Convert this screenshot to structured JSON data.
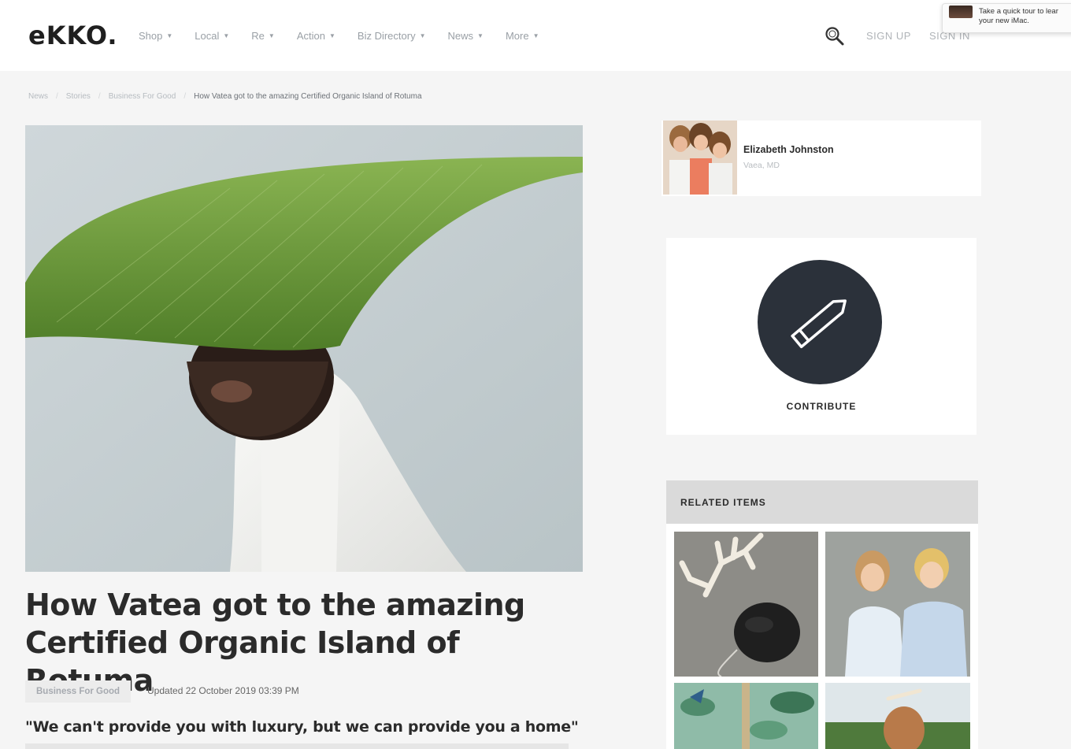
{
  "header": {
    "logo": "eKKO.",
    "nav": [
      {
        "label": "Shop"
      },
      {
        "label": "Local"
      },
      {
        "label": "Re"
      },
      {
        "label": "Action"
      },
      {
        "label": "Biz Directory"
      },
      {
        "label": "News"
      },
      {
        "label": "More"
      }
    ],
    "search_icon": "search-icon",
    "signup": "SIGN UP",
    "signin": "SIGN IN"
  },
  "notification": {
    "text_line1": "Take a quick tour to lear",
    "text_line2": "your new iMac."
  },
  "breadcrumb": {
    "items": [
      "News",
      "Stories",
      "Business For Good"
    ],
    "current": "How Vatea got to the amazing Certified Organic Island of Rotuma"
  },
  "article": {
    "title": "How Vatea got to the amazing Certified Organic Island of Rotuma",
    "category": "Business For Good",
    "updated": "Updated 22 October 2019 03:39 PM",
    "quote": "\"We can't provide you with luxury, but we can provide you a home\""
  },
  "author": {
    "name": "Elizabeth Johnston",
    "location": "Vaea, MD"
  },
  "contribute": {
    "label": "CONTRIBUTE",
    "icon": "pencil-icon"
  },
  "related": {
    "label": "RELATED ITEMS"
  },
  "colors": {
    "contribute_circle": "#2b313a",
    "leaf_green": "#6b9b3a",
    "background": "#f5f5f5"
  }
}
